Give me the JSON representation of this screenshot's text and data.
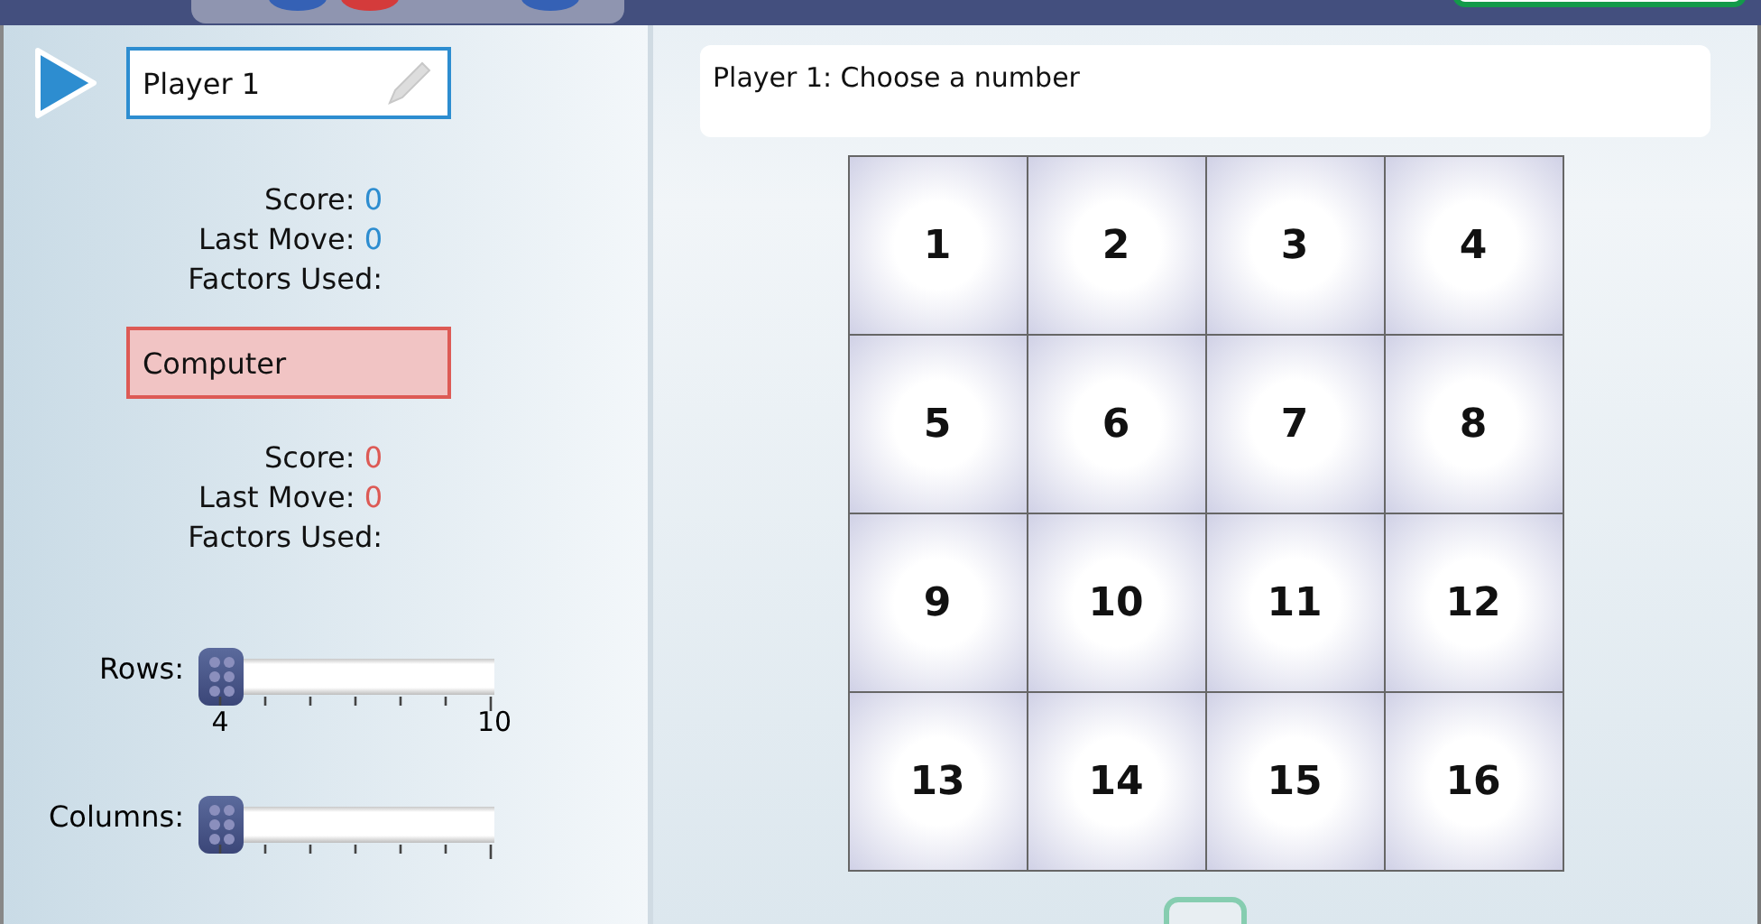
{
  "players": [
    {
      "name": "Player 1",
      "kind": "human",
      "active": true,
      "score": "0",
      "last_move": "0",
      "score_label": "Score:",
      "last_move_label": "Last Move:",
      "factors_label": "Factors Used:"
    },
    {
      "name": "Computer",
      "kind": "computer",
      "active": false,
      "score": "0",
      "last_move": "0",
      "score_label": "Score:",
      "last_move_label": "Last Move:",
      "factors_label": "Factors Used:"
    }
  ],
  "sliders": [
    {
      "label": "Rows:",
      "min_label": "4",
      "max_label": "10"
    },
    {
      "label": "Columns:"
    }
  ],
  "message": "Player 1: Choose a number",
  "grid": {
    "cells": [
      "1",
      "2",
      "3",
      "4",
      "5",
      "6",
      "7",
      "8",
      "9",
      "10",
      "11",
      "12",
      "13",
      "14",
      "15",
      "16"
    ]
  }
}
